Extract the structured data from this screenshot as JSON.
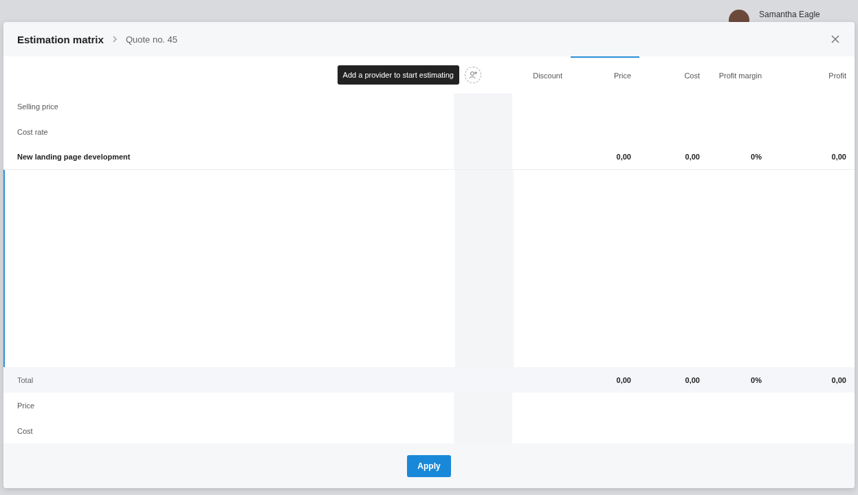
{
  "app_nav": {
    "user": "Samantha Eagle"
  },
  "modal": {
    "title": "Estimation matrix",
    "breadcrumb": "Quote no. 45",
    "tooltip": "Add a provider to start estimating",
    "columns": [
      {
        "label": "Discount",
        "selected": false
      },
      {
        "label": "Price",
        "selected": true
      },
      {
        "label": "Cost",
        "selected": false
      },
      {
        "label": "Profit margin",
        "selected": false
      },
      {
        "label": "Profit",
        "selected": false
      }
    ],
    "rows": [
      {
        "kind": "label",
        "label": "Selling price"
      },
      {
        "kind": "label",
        "label": "Cost rate"
      },
      {
        "kind": "item",
        "label": "New landing page development",
        "values": [
          "0,00",
          "0,00",
          "0%",
          "0,00"
        ]
      }
    ],
    "total": {
      "label": "Total",
      "values": [
        "0,00",
        "0,00",
        "0%",
        "0,00"
      ]
    },
    "summary_rows": [
      {
        "label": "Price"
      },
      {
        "label": "Cost"
      }
    ],
    "apply_button": "Apply"
  }
}
